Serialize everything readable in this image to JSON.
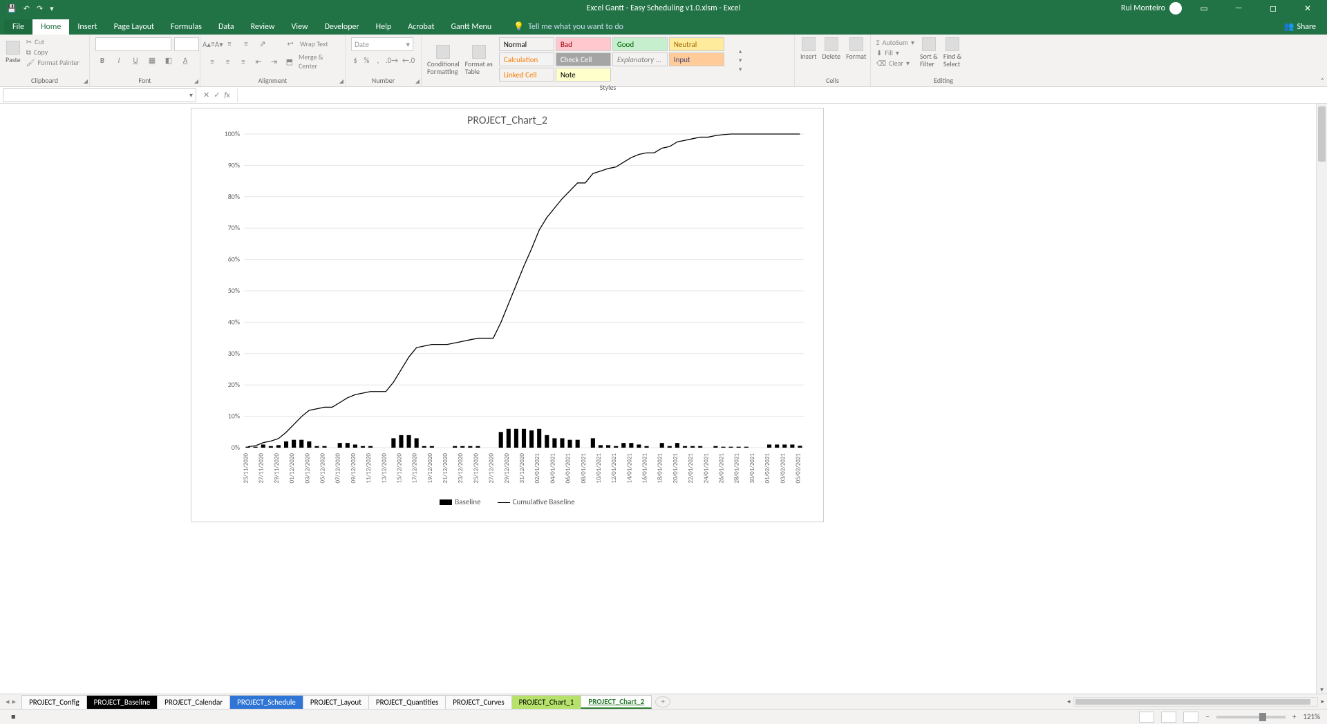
{
  "titlebar": {
    "title": "Excel Gantt - Easy Scheduling v1.0.xlsm  -  Excel",
    "user": "Rui Monteiro"
  },
  "menu": {
    "file": "File",
    "home": "Home",
    "insert": "Insert",
    "pagelayout": "Page Layout",
    "formulas": "Formulas",
    "data": "Data",
    "review": "Review",
    "view": "View",
    "developer": "Developer",
    "help": "Help",
    "acrobat": "Acrobat",
    "ganttmenu": "Gantt Menu",
    "tellme": "Tell me what you want to do",
    "share": "Share"
  },
  "ribbon": {
    "clipboard": {
      "label": "Clipboard",
      "paste": "Paste",
      "cut": "Cut",
      "copy": "Copy",
      "fmtpaint": "Format Painter"
    },
    "font": {
      "label": "Font"
    },
    "alignment": {
      "label": "Alignment",
      "wrap": "Wrap Text",
      "merge": "Merge & Center"
    },
    "number": {
      "label": "Number",
      "format": "Date"
    },
    "styles": {
      "label": "Styles",
      "condfmt": "Conditional\nFormatting",
      "fmttable": "Format as\nTable",
      "normal": "Normal",
      "bad": "Bad",
      "good": "Good",
      "neutral": "Neutral",
      "calculation": "Calculation",
      "checkcell": "Check Cell",
      "explanatory": "Explanatory ...",
      "input": "Input",
      "linkedcell": "Linked Cell",
      "note": "Note"
    },
    "cells": {
      "label": "Cells",
      "insert": "Insert",
      "delete": "Delete",
      "format": "Format"
    },
    "editing": {
      "label": "Editing",
      "autosum": "AutoSum",
      "fill": "Fill",
      "clear": "Clear",
      "sortfilter": "Sort &\nFilter",
      "findselect": "Find &\nSelect"
    }
  },
  "sheets": {
    "tabs": [
      "PROJECT_Config",
      "PROJECT_Baseline",
      "PROJECT_Calendar",
      "PROJECT_Schedule",
      "PROJECT_Layout",
      "PROJECT_Quantities",
      "PROJECT_Curves",
      "PROJECT_Chart_1",
      "PROJECT_Chart_2"
    ]
  },
  "statusbar": {
    "ready": "",
    "zoom": "121%"
  },
  "chart_data": {
    "type": "combo",
    "title": "PROJECT_Chart_2",
    "ylabel": "",
    "ylim": [
      0,
      100
    ],
    "yticks": [
      0,
      10,
      20,
      30,
      40,
      50,
      60,
      70,
      80,
      90,
      100
    ],
    "categories": [
      "25/11/2020",
      "27/11/2020",
      "29/11/2020",
      "01/12/2020",
      "03/12/2020",
      "05/12/2020",
      "07/12/2020",
      "09/12/2020",
      "11/12/2020",
      "13/12/2020",
      "15/12/2020",
      "17/12/2020",
      "19/12/2020",
      "21/12/2020",
      "23/12/2020",
      "25/12/2020",
      "27/12/2020",
      "29/12/2020",
      "31/12/2020",
      "02/01/2021",
      "04/01/2021",
      "06/01/2021",
      "08/01/2021",
      "10/01/2021",
      "12/01/2021",
      "14/01/2021",
      "16/01/2021",
      "18/01/2021",
      "20/01/2021",
      "22/01/2021",
      "24/01/2021",
      "26/01/2021",
      "28/01/2021",
      "30/01/2021",
      "01/02/2021",
      "03/02/2021",
      "05/02/2021"
    ],
    "series": [
      {
        "name": "Baseline",
        "type": "bar",
        "x": [
          "25/11/2020",
          "26/11/2020",
          "27/11/2020",
          "28/11/2020",
          "29/11/2020",
          "30/11/2020",
          "01/12/2020",
          "02/12/2020",
          "03/12/2020",
          "04/12/2020",
          "05/12/2020",
          "06/12/2020",
          "07/12/2020",
          "08/12/2020",
          "09/12/2020",
          "10/12/2020",
          "11/12/2020",
          "12/12/2020",
          "13/12/2020",
          "14/12/2020",
          "15/12/2020",
          "16/12/2020",
          "17/12/2020",
          "18/12/2020",
          "19/12/2020",
          "20/12/2020",
          "21/12/2020",
          "22/12/2020",
          "23/12/2020",
          "24/12/2020",
          "25/12/2020",
          "26/12/2020",
          "27/12/2020",
          "28/12/2020",
          "29/12/2020",
          "30/12/2020",
          "31/12/2020",
          "01/01/2021",
          "02/01/2021",
          "03/01/2021",
          "04/01/2021",
          "05/01/2021",
          "06/01/2021",
          "07/01/2021",
          "08/01/2021",
          "09/01/2021",
          "10/01/2021",
          "11/01/2021",
          "12/01/2021",
          "13/01/2021",
          "14/01/2021",
          "15/01/2021",
          "16/01/2021",
          "17/01/2021",
          "18/01/2021",
          "19/01/2021",
          "20/01/2021",
          "21/01/2021",
          "22/01/2021",
          "23/01/2021",
          "24/01/2021",
          "25/01/2021",
          "26/01/2021",
          "27/01/2021",
          "28/01/2021",
          "29/01/2021",
          "30/01/2021",
          "31/01/2021",
          "01/02/2021",
          "02/02/2021",
          "03/02/2021",
          "04/02/2021",
          "05/02/2021"
        ],
        "values": [
          0.3,
          0.3,
          1.0,
          0.5,
          0.8,
          2.0,
          2.5,
          2.5,
          2.0,
          0.5,
          0.5,
          0,
          1.5,
          1.5,
          1.0,
          0.5,
          0.5,
          0,
          0,
          3.0,
          4.0,
          4.0,
          3.0,
          0.5,
          0.5,
          0,
          0,
          0.5,
          0.5,
          0.5,
          0.5,
          0,
          0,
          5.0,
          6.0,
          6.0,
          6.0,
          5.5,
          6.0,
          4.0,
          3.0,
          3.0,
          2.5,
          2.5,
          0,
          3.0,
          0.8,
          0.8,
          0.5,
          1.5,
          1.5,
          1.0,
          0.5,
          0,
          1.5,
          0.5,
          1.5,
          0.5,
          0.5,
          0.5,
          0,
          0.5,
          0.3,
          0.3,
          0.3,
          0.3,
          0,
          0,
          1.0,
          1.0,
          1.0,
          1.0,
          0.6
        ]
      },
      {
        "name": "Cumulative Baseline",
        "type": "line",
        "x": [
          "25/11/2020",
          "26/11/2020",
          "27/11/2020",
          "28/11/2020",
          "29/11/2020",
          "30/11/2020",
          "01/12/2020",
          "02/12/2020",
          "03/12/2020",
          "04/12/2020",
          "05/12/2020",
          "06/12/2020",
          "07/12/2020",
          "08/12/2020",
          "09/12/2020",
          "10/12/2020",
          "11/12/2020",
          "12/12/2020",
          "13/12/2020",
          "14/12/2020",
          "15/12/2020",
          "16/12/2020",
          "17/12/2020",
          "18/12/2020",
          "19/12/2020",
          "20/12/2020",
          "21/12/2020",
          "22/12/2020",
          "23/12/2020",
          "24/12/2020",
          "25/12/2020",
          "26/12/2020",
          "27/12/2020",
          "28/12/2020",
          "29/12/2020",
          "30/12/2020",
          "31/12/2020",
          "01/01/2021",
          "02/01/2021",
          "03/01/2021",
          "04/01/2021",
          "05/01/2021",
          "06/01/2021",
          "07/01/2021",
          "08/01/2021",
          "09/01/2021",
          "10/01/2021",
          "11/01/2021",
          "12/01/2021",
          "13/01/2021",
          "14/01/2021",
          "15/01/2021",
          "16/01/2021",
          "17/01/2021",
          "18/01/2021",
          "19/01/2021",
          "20/01/2021",
          "21/01/2021",
          "22/01/2021",
          "23/01/2021",
          "24/01/2021",
          "25/01/2021",
          "26/01/2021",
          "27/01/2021",
          "28/01/2021",
          "29/01/2021",
          "30/01/2021",
          "31/01/2021",
          "01/02/2021",
          "02/02/2021",
          "03/02/2021",
          "04/02/2021",
          "05/02/2021"
        ],
        "values": [
          0.3,
          0.6,
          1.6,
          2.1,
          2.9,
          4.9,
          7.4,
          9.9,
          11.9,
          12.4,
          12.9,
          12.9,
          14.4,
          15.9,
          16.9,
          17.4,
          17.9,
          17.9,
          17.9,
          20.9,
          24.9,
          28.9,
          31.9,
          32.4,
          32.9,
          32.9,
          32.9,
          33.4,
          33.9,
          34.4,
          34.9,
          34.9,
          34.9,
          39.9,
          45.9,
          51.9,
          57.9,
          63.4,
          69.4,
          73.4,
          76.4,
          79.4,
          81.9,
          84.4,
          84.4,
          87.4,
          88.2,
          89.0,
          89.5,
          91.0,
          92.5,
          93.5,
          94.0,
          94.0,
          95.5,
          96.0,
          97.5,
          98.0,
          98.5,
          99.0,
          99.0,
          99.5,
          99.8,
          100,
          100,
          100,
          100,
          100,
          100,
          100,
          100,
          100,
          100
        ]
      }
    ],
    "legend": [
      "Baseline",
      "Cumulative Baseline"
    ]
  }
}
